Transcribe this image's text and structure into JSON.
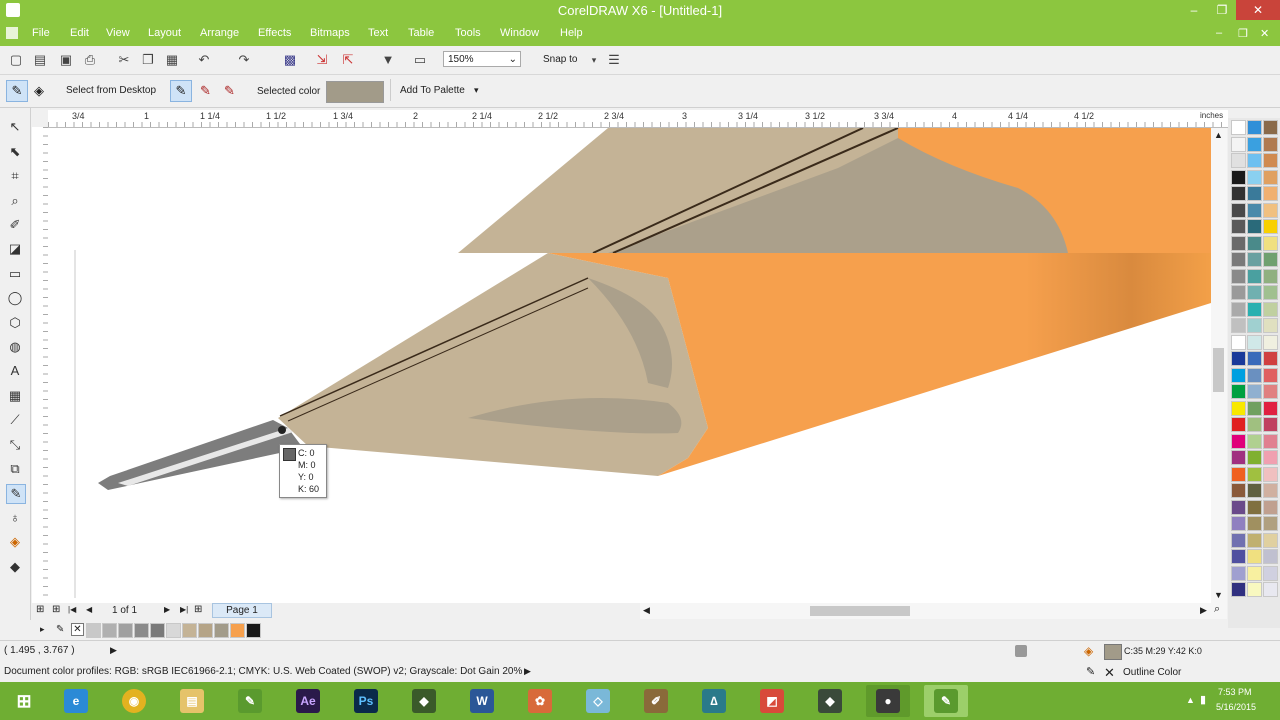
{
  "window": {
    "title": "CorelDRAW X6 - [Untitled-1]",
    "minimize": "–",
    "restore": "❐",
    "close": "✕"
  },
  "menu": [
    "File",
    "Edit",
    "View",
    "Layout",
    "Arrange",
    "Effects",
    "Bitmaps",
    "Text",
    "Table",
    "Tools",
    "Window",
    "Help"
  ],
  "toolbar": {
    "zoom": "150%",
    "snap_to": "Snap to"
  },
  "propbar": {
    "select_from_desktop": "Select from Desktop",
    "selected_color_label": "Selected color",
    "selected_color": "#a29b89",
    "add_to_palette": "Add To Palette"
  },
  "ruler": {
    "unit": "inches",
    "ticks": [
      "3/4",
      "1",
      "1 1/4",
      "1 1/2",
      "1 3/4",
      "2",
      "2 1/4",
      "2 1/2",
      "2 3/4",
      "3",
      "3 1/4",
      "3 1/2",
      "3 3/4",
      "4",
      "4 1/4",
      "4 1/2"
    ]
  },
  "tooltip": {
    "c": "C: 0",
    "m": "M: 0",
    "y": "Y: 0",
    "k": "K: 60"
  },
  "pagebar": {
    "page_count": "1 of 1",
    "page_tab": "Page 1"
  },
  "status": {
    "coords": "( 1.495 , 3.767 )",
    "profiles": "Document color profiles: RGB: sRGB IEC61966-2.1; CMYK: U.S. Web Coated (SWOP) v2; Grayscale: Dot Gain 20%",
    "fill_info": "C:35 M:29 Y:42 K:0",
    "outline_label": "Outline Color"
  },
  "clock": {
    "time": "7:53 PM",
    "date": "5/16/2015"
  },
  "colors": {
    "chrome_green": "#8cc63f",
    "taskbar_green": "#6fae33",
    "orange": "#f6a04d",
    "wood": "#c4b396",
    "wood_dark": "#b5a487",
    "lead": "#7d7d7d"
  }
}
